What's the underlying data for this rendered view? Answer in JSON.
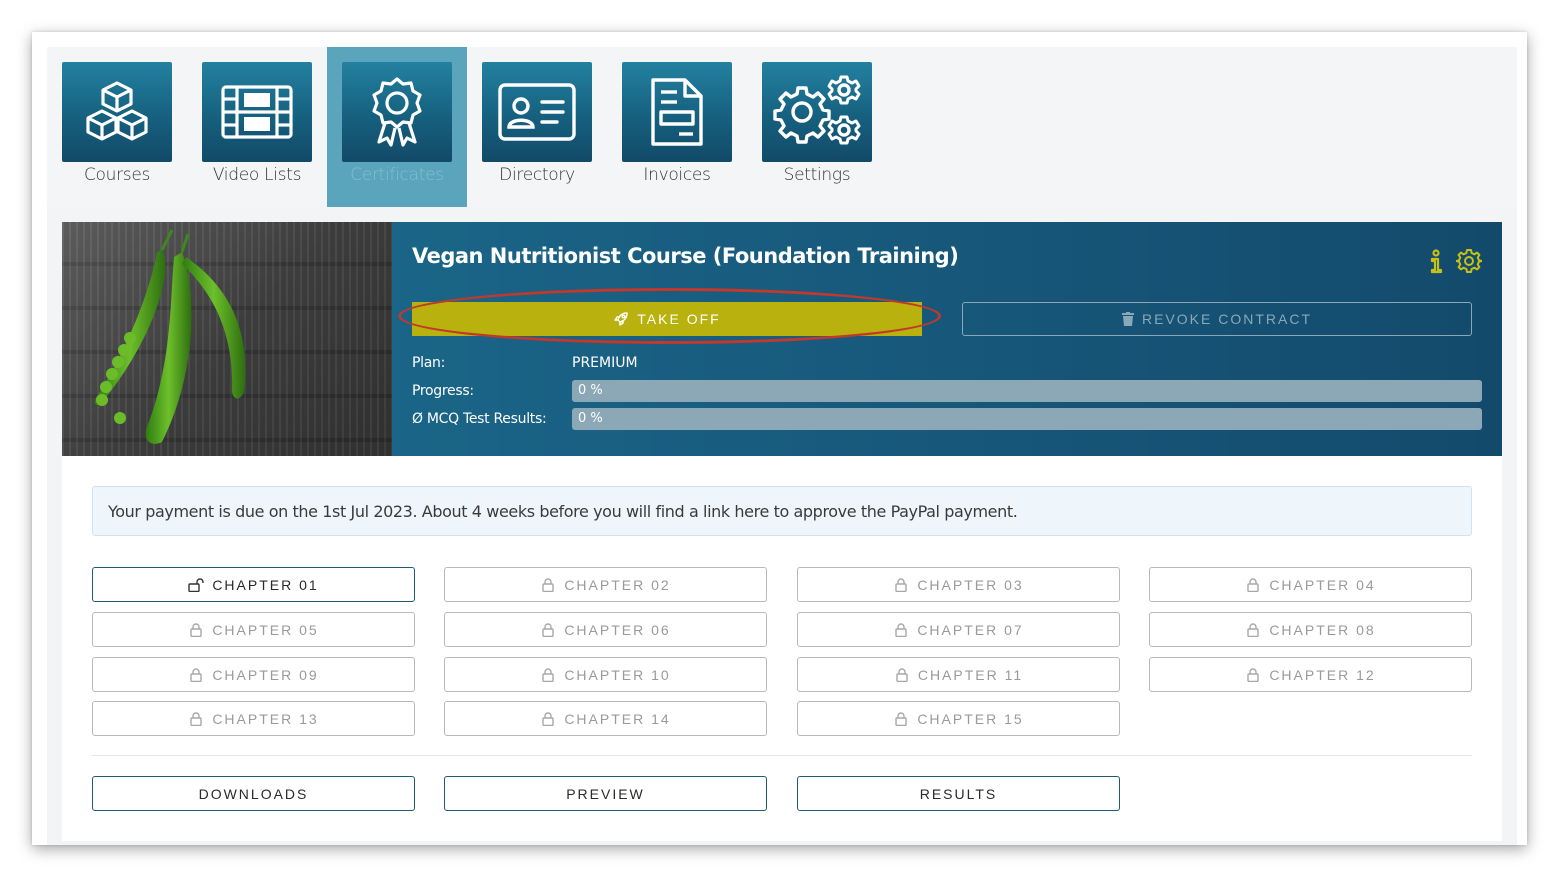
{
  "nav": {
    "items": [
      {
        "label": "Courses",
        "icon": "cubes-icon"
      },
      {
        "label": "Video Lists",
        "icon": "film-icon"
      },
      {
        "label": "Certificates",
        "icon": "award-icon",
        "active": true
      },
      {
        "label": "Directory",
        "icon": "id-card-icon"
      },
      {
        "label": "Invoices",
        "icon": "document-icon"
      },
      {
        "label": "Settings",
        "icon": "gears-icon"
      }
    ]
  },
  "course": {
    "title": "Vegan Nutritionist Course (Foundation Training)",
    "take_off_label": "TAKE OFF",
    "revoke_label": "REVOKE CONTRACT",
    "plan_label": "Plan:",
    "plan_value": "PREMIUM",
    "progress_label": "Progress:",
    "progress_text": "0 %",
    "progress_value": 0,
    "mcq_label": "Ø MCQ Test Results:",
    "mcq_text": "0 %",
    "mcq_value": 0
  },
  "notice": "Your payment is due on the 1st Jul 2023. About 4 weeks before you will find a link here to approve the PayPal payment.",
  "chapters": [
    {
      "label": "CHAPTER 01",
      "locked": false
    },
    {
      "label": "CHAPTER 02",
      "locked": true
    },
    {
      "label": "CHAPTER 03",
      "locked": true
    },
    {
      "label": "CHAPTER 04",
      "locked": true
    },
    {
      "label": "CHAPTER 05",
      "locked": true
    },
    {
      "label": "CHAPTER 06",
      "locked": true
    },
    {
      "label": "CHAPTER 07",
      "locked": true
    },
    {
      "label": "CHAPTER 08",
      "locked": true
    },
    {
      "label": "CHAPTER 09",
      "locked": true
    },
    {
      "label": "CHAPTER 10",
      "locked": true
    },
    {
      "label": "CHAPTER 11",
      "locked": true
    },
    {
      "label": "CHAPTER 12",
      "locked": true
    },
    {
      "label": "CHAPTER 13",
      "locked": true
    },
    {
      "label": "CHAPTER 14",
      "locked": true
    },
    {
      "label": "CHAPTER 15",
      "locked": true
    }
  ],
  "actions": {
    "downloads": "DOWNLOADS",
    "preview": "PREVIEW",
    "results": "RESULTS"
  },
  "colors": {
    "brand": "#16607f",
    "accent": "#b9b10d",
    "highlight": "#c0392b",
    "active_tab": "#5aa5bb"
  }
}
